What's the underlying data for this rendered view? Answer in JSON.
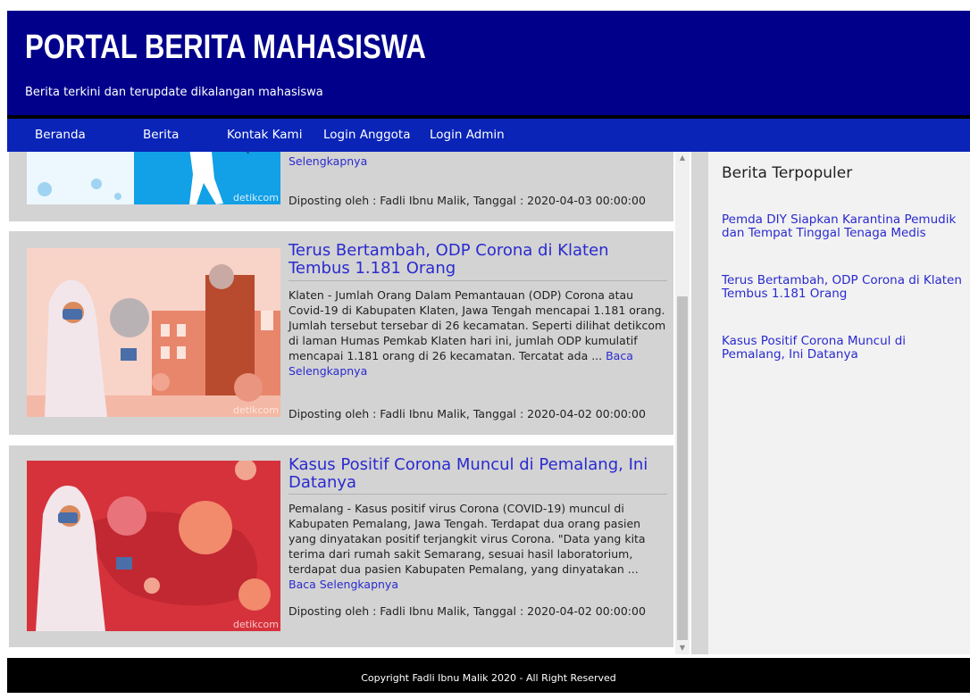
{
  "header": {
    "title": "PORTAL BERITA MAHASISWA",
    "tagline": "Berita terkini dan terupdate dikalangan mahasiswa",
    "bg_color": "#00008b"
  },
  "nav": {
    "items": [
      "Beranda",
      "Berita",
      "Kontak Kami",
      "Login Anggota",
      "Login Admin"
    ],
    "bg_color": "#0a24b8"
  },
  "articles": [
    {
      "title": "",
      "excerpt_tail": "",
      "read_more": "Selengkapnya",
      "meta": "Diposting oleh : Fadli Ibnu Malik, Tanggal : 2020-04-03 00:00:00",
      "image_credit": "detikcom"
    },
    {
      "title": "Terus Bertambah, ODP Corona di Klaten Tembus 1.181 Orang",
      "excerpt": "Klaten - Jumlah Orang Dalam Pemantauan (ODP) Corona atau Covid-19 di Kabupaten Klaten, Jawa Tengah mencapai 1.181 orang. Jumlah tersebut tersebar di 26 kecamatan. Seperti dilihat detikcom di laman Humas Pemkab Klaten hari ini, jumlah ODP kumulatif mencapai 1.181 orang di 26 kecamatan. Tercatat ada ...",
      "read_more": "Baca Selengkapnya",
      "meta": "Diposting oleh : Fadli Ibnu Malik, Tanggal : 2020-04-02 00:00:00",
      "image_credit": "detikcom"
    },
    {
      "title": "Kasus Positif Corona Muncul di Pemalang, Ini Datanya",
      "excerpt": "Pemalang - Kasus positif virus Corona (COVID-19) muncul di Kabupaten Pemalang, Jawa Tengah. Terdapat dua orang pasien yang dinyatakan positif terjangkit virus Corona. \"Data yang kita terima dari rumah sakit Semarang, sesuai hasil laboratorium, terdapat dua pasien Kabupaten Pemalang, yang dinyatakan ...",
      "read_more": "Baca Selengkapnya",
      "meta": "Diposting oleh : Fadli Ibnu Malik, Tanggal : 2020-04-02 00:00:00",
      "image_credit": "detikcom"
    }
  ],
  "sidebar": {
    "heading": "Berita Terpopuler",
    "links": [
      "Pemda DIY Siapkan Karantina Pemudik dan Tempat Tinggal Tenaga Medis",
      "Terus Bertambah, ODP Corona di Klaten Tembus 1.181 Orang",
      "Kasus Positif Corona Muncul di Pemalang, Ini Datanya"
    ]
  },
  "footer": {
    "text": "Copyright Fadli Ibnu Malik 2020 - All Right Reserved"
  },
  "colors": {
    "link": "#2a2acf",
    "card_bg": "#d3d3d3",
    "footer_bg": "#000000"
  }
}
